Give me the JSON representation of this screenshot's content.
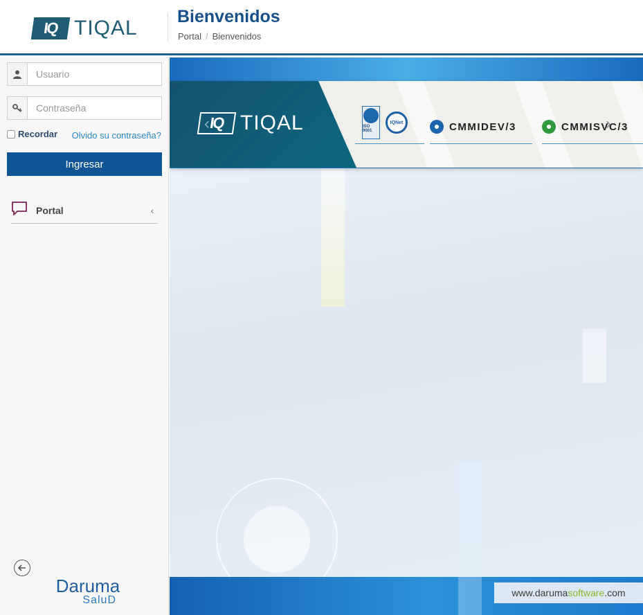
{
  "header": {
    "logo_mark": "IQ",
    "logo_text": "TIQAL",
    "title": "Bienvenidos",
    "breadcrumb": [
      "Portal",
      "Bienvenidos"
    ],
    "breadcrumb_sep": "/"
  },
  "login": {
    "username_placeholder": "Usuario",
    "password_placeholder": "Contraseña",
    "remember_label": "Recordar",
    "forgot_label": "Olvido su contraseña?",
    "submit_label": "Ingresar"
  },
  "menu": {
    "items": [
      {
        "label": "Portal",
        "icon": "chat-bubble-icon",
        "chevron": "‹"
      }
    ]
  },
  "sidebar_footer": {
    "back_icon": "arrow-left-circle-icon",
    "brand_line1": "Daruma",
    "brand_line2": "SaluD"
  },
  "banner": {
    "logo_mark": "IQ",
    "logo_text": "TIQAL",
    "iso_label": "ISO 9001",
    "iqnet_label": "IQNet",
    "cmmi_dev": "CMMIDEV/3",
    "cmmi_svc": "CMMISVC/3",
    "prev_arrow": "‹",
    "next_arrow": "›"
  },
  "footer_badge": {
    "prefix": "www.daruma",
    "accent": "software",
    "suffix": ".com"
  },
  "colors": {
    "brand_blue": "#0f5495",
    "title_blue": "#17508a",
    "teal": "#1e5c74",
    "accent_green": "#8ab82d",
    "menu_icon": "#7b2252"
  }
}
